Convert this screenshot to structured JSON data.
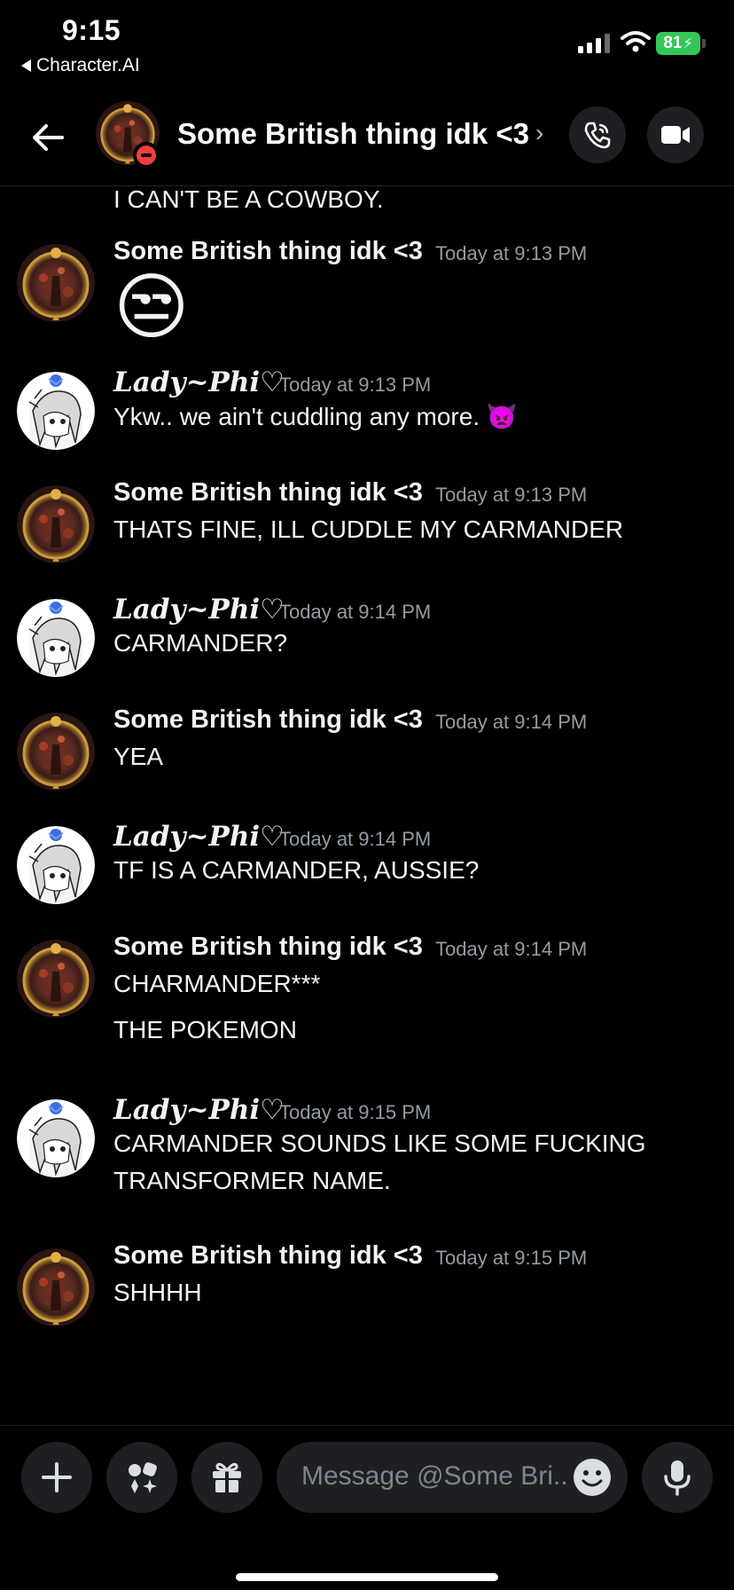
{
  "status_bar": {
    "time": "9:15",
    "back_app": "Character.AI",
    "battery": "81"
  },
  "header": {
    "title": "Some British thing idk <3",
    "chevron": "›"
  },
  "messages": {
    "partial_top": "I CAN'T BE A COWBOY.",
    "m1": {
      "author": "Some British thing idk <3",
      "time": "Today at 9:13 PM",
      "emoji": "😒"
    },
    "m2": {
      "author": "Lady~Phi♡",
      "time": "Today at 9:13 PM",
      "text": "Ykw.. we ain't cuddling any more.",
      "emoji": "👿"
    },
    "m3": {
      "author": "Some British thing idk <3",
      "time": "Today at 9:13 PM",
      "text": "THATS FINE, ILL CUDDLE MY CARMANDER"
    },
    "m4": {
      "author": "Lady~Phi♡",
      "time": "Today at 9:14 PM",
      "text": "CARMANDER?"
    },
    "m5": {
      "author": "Some British thing idk <3",
      "time": "Today at 9:14 PM",
      "text": "YEA"
    },
    "m6": {
      "author": "Lady~Phi♡",
      "time": "Today at 9:14 PM",
      "text": "TF IS A CARMANDER, AUSSIE?"
    },
    "m7": {
      "author": "Some British thing idk <3",
      "time": "Today at 9:14 PM",
      "text": "CHARMANDER***",
      "text2": "THE POKEMON"
    },
    "m8": {
      "author": "Lady~Phi♡",
      "time": "Today at 9:15 PM",
      "text": "CARMANDER SOUNDS LIKE SOME FUCKING",
      "text2": "TRANSFORMER NAME."
    },
    "m9": {
      "author": "Some British thing idk <3",
      "time": "Today at 9:15 PM",
      "text": "SHHHH"
    }
  },
  "composer": {
    "placeholder": "Message @Some Bri.."
  },
  "icons": [
    "back-arrow-icon",
    "phone-icon",
    "video-camera-icon",
    "plus-icon",
    "apps-icon",
    "gift-icon",
    "emoji-icon",
    "microphone-icon"
  ],
  "colors": {
    "background": "#000000",
    "button_bg": "#1e1f22",
    "timestamp": "#949ba4",
    "dnd": "#f23f43",
    "battery": "#33c759"
  }
}
